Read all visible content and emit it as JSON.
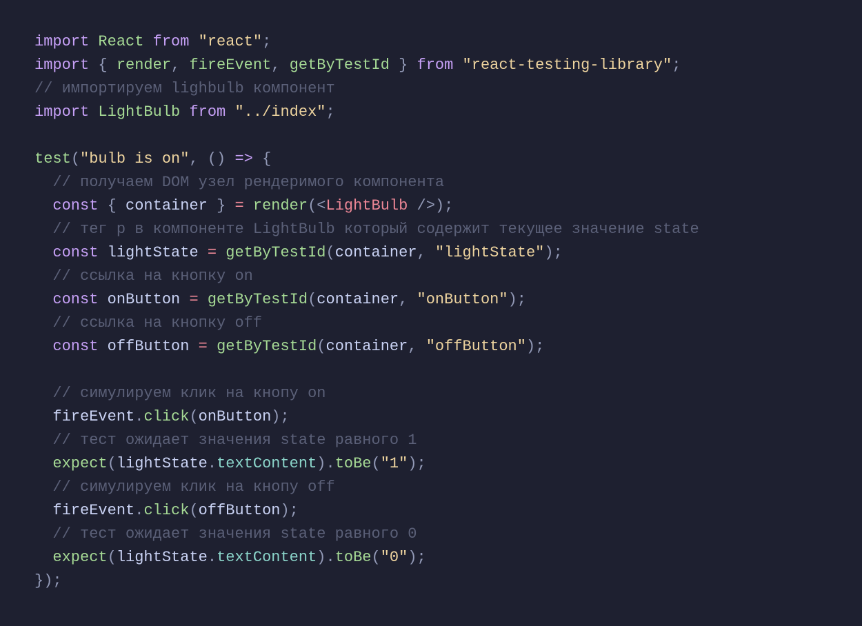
{
  "c": {
    "import": "import",
    "from": "from",
    "const": "const",
    "React": "React",
    "render": "render",
    "fireEvent": "fireEvent",
    "getByTestId": "getByTestId",
    "LightBulb": "LightBulb",
    "test": "test",
    "container": "container",
    "lightState_var": "lightState",
    "onButton_var": "onButton",
    "offButton_var": "offButton",
    "click": "click",
    "expect": "expect",
    "textContent": "textContent",
    "toBe": "toBe",
    "s_react": "\"react\"",
    "s_rtl": "\"react-testing-library\"",
    "s_index": "\"../index\"",
    "s_bulb": "\"bulb is on\"",
    "s_lightState": "\"lightState\"",
    "s_onButton": "\"onButton\"",
    "s_offButton": "\"offButton\"",
    "s_1": "\"1\"",
    "s_0": "\"0\"",
    "cm_import": "// импортируем lighbulb компонент",
    "cm_dom": "// получаем DOM узел рендеримого компонента",
    "cm_p": "// тег p в компоненте LightBulb который содержит текущее значение state",
    "cm_on": "// ссылка на кнопку on",
    "cm_off": "// ссылка на кнопку off",
    "cm_sim_on": "// симулируем клик на кнопу on",
    "cm_state1": "// тест ожидает значения state равного 1",
    "cm_sim_off": "// симулируем клик на кнопу off",
    "cm_state0": "// тест ожидает значения state равного 0",
    "arrow": "=>",
    "jsx_open": "<",
    "jsx_close": " />"
  }
}
